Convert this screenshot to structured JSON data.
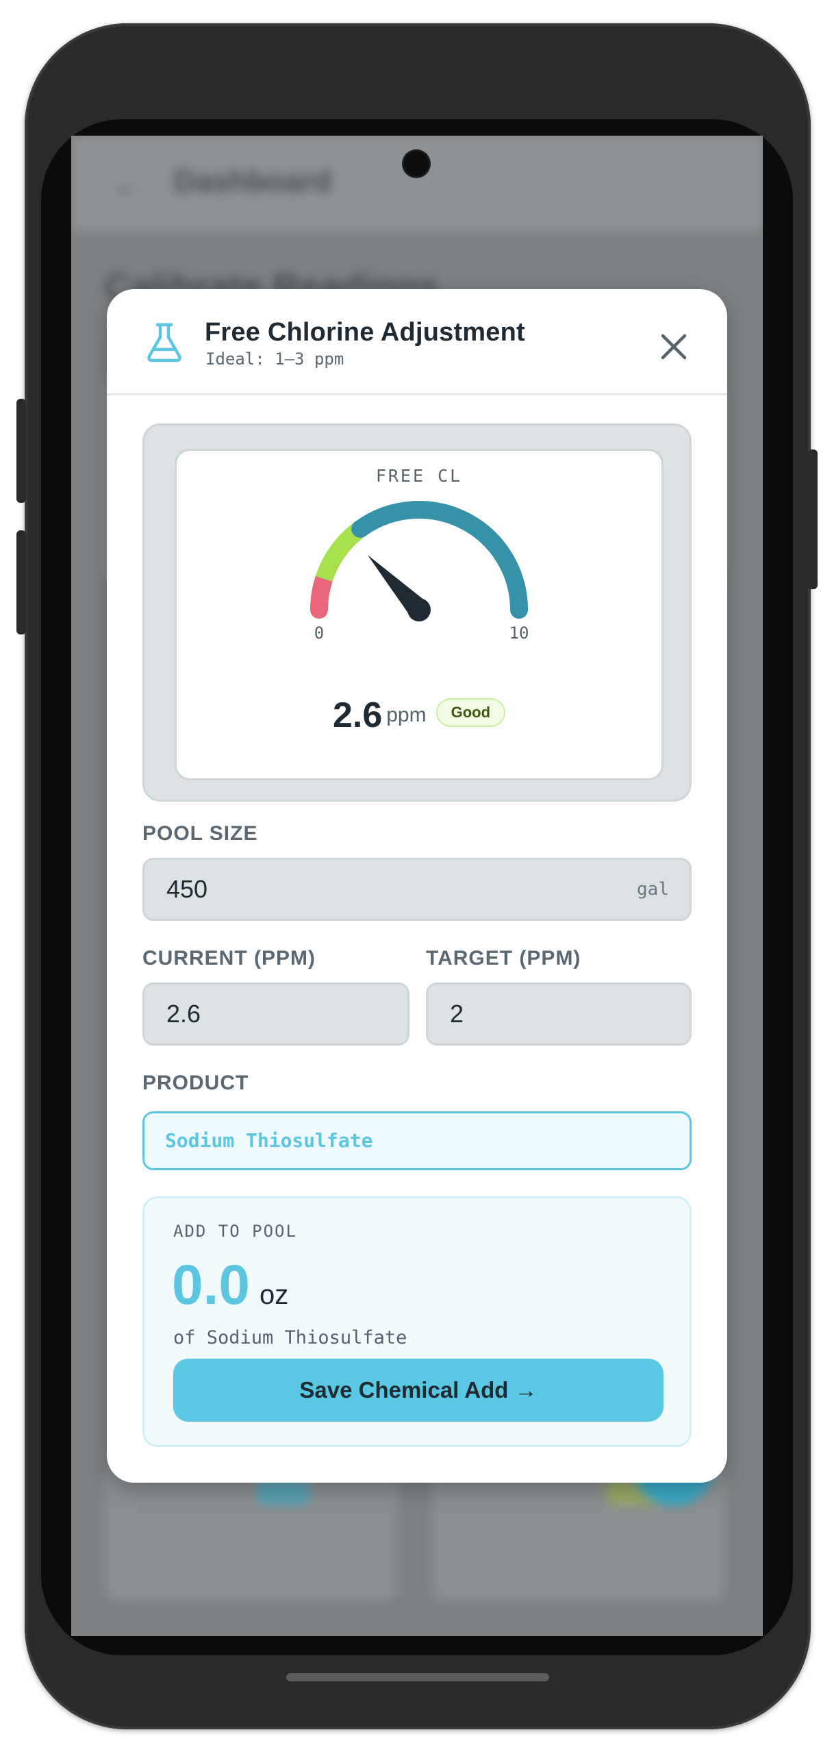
{
  "background_app": {
    "back_icon": "back-arrow-icon",
    "app_title": "Dashboard",
    "heading": "Calibrate Readings"
  },
  "modal": {
    "icon": "flask-icon",
    "title": "Free Chlorine Adjustment",
    "subtitle": "Ideal: 1–3 ppm",
    "close_icon": "close-icon"
  },
  "gauge": {
    "label": "FREE CL",
    "min": 0,
    "max": 10,
    "min_label": "0",
    "max_label": "10",
    "value": 2.6,
    "value_text": "2.6",
    "unit": "ppm",
    "status": "Good",
    "zones": [
      {
        "from": 0,
        "to": 1,
        "color": "#e8687a"
      },
      {
        "from": 1,
        "to": 3,
        "color": "#a8e04d"
      },
      {
        "from": 3,
        "to": 10,
        "color": "#3592a9"
      }
    ],
    "needle_color": "#1f2a33"
  },
  "pool_size": {
    "label": "POOL SIZE",
    "value": "450",
    "unit": "gal"
  },
  "current": {
    "label": "CURRENT (PPM)",
    "value": "2.6"
  },
  "target": {
    "label": "TARGET (PPM)",
    "value": "2"
  },
  "product": {
    "label": "PRODUCT",
    "value": "Sodium Thiosulfate"
  },
  "result": {
    "label": "ADD TO POOL",
    "value": "0.0",
    "unit": "oz",
    "of_text": "of Sodium Thiosulfate",
    "button_label": "Save Chemical Add →"
  },
  "colors": {
    "accent": "#5ac8e2",
    "text_dark": "#1f2a33",
    "text_muted": "#5b6872"
  }
}
